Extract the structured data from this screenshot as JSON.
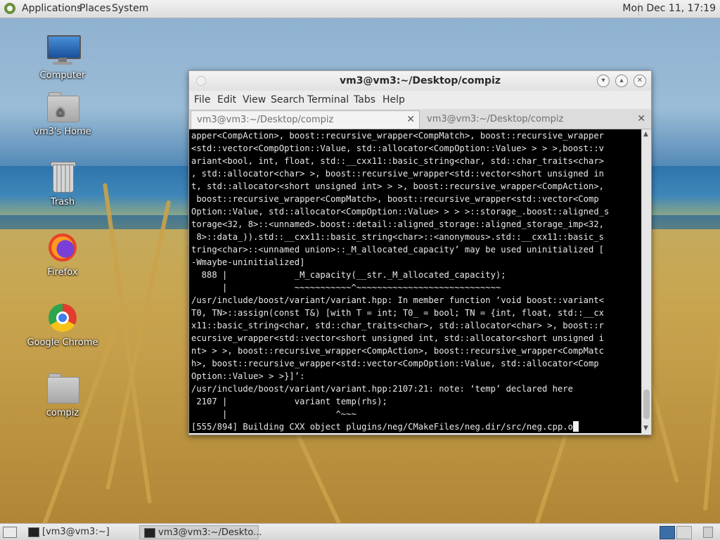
{
  "top_panel": {
    "menus": [
      "Applications",
      "Places",
      "System"
    ],
    "clock": "Mon Dec 11, 17:19"
  },
  "desktop_icons": [
    {
      "label": "Computer",
      "icon": "computer-icon"
    },
    {
      "label": "vm3's Home",
      "icon": "home-folder-icon"
    },
    {
      "label": "Trash",
      "icon": "trash-icon"
    },
    {
      "label": "Firefox",
      "icon": "firefox-icon"
    },
    {
      "label": "Google Chrome",
      "icon": "chrome-icon"
    },
    {
      "label": "compiz",
      "icon": "folder-icon"
    }
  ],
  "terminal": {
    "title": "vm3@vm3:~/Desktop/compiz",
    "menu": [
      "File",
      "Edit",
      "View",
      "Search",
      "Terminal",
      "Tabs",
      "Help"
    ],
    "tabs": [
      {
        "label": "vm3@vm3:~/Desktop/compiz",
        "active": true
      },
      {
        "label": "vm3@vm3:~/Desktop/compiz",
        "active": false
      }
    ],
    "lines": [
      "apper<CompAction>, boost::recursive_wrapper<CompMatch>, boost::recursive_wrapper",
      "<std::vector<CompOption::Value, std::allocator<CompOption::Value> > > >,boost::v",
      "ariant<bool, int, float, std::__cxx11::basic_string<char, std::char_traits<char>",
      ", std::allocator<char> >, boost::recursive_wrapper<std::vector<short unsigned in",
      "t, std::allocator<short unsigned int> > >, boost::recursive_wrapper<CompAction>,",
      " boost::recursive_wrapper<CompMatch>, boost::recursive_wrapper<std::vector<Comp",
      "Option::Value, std::allocator<CompOption::Value> > > >::storage_.boost::aligned_s",
      "torage<32, 8>::<unnamed>.boost::detail::aligned_storage::aligned_storage_imp<32,",
      " 8>::data_)).std::__cxx11::basic_string<char>::<anonymous>.std::__cxx11::basic_s",
      "tring<char>::<unnamed union>::_M_allocated_capacity’ may be used uninitialized [",
      "-Wmaybe-uninitialized]",
      "  888 |             _M_capacity(__str._M_allocated_capacity);",
      "      |             ~~~~~~~~~~~^~~~~~~~~~~~~~~~~~~~~~~~~~~~~",
      "/usr/include/boost/variant/variant.hpp: In member function ‘void boost::variant<",
      "T0, TN>::assign(const T&) [with T = int; T0_ = bool; TN = {int, float, std::__cx",
      "x11::basic_string<char, std::char_traits<char>, std::allocator<char> >, boost::r",
      "ecursive_wrapper<std::vector<short unsigned int, std::allocator<short unsigned i",
      "nt> > >, boost::recursive_wrapper<CompAction>, boost::recursive_wrapper<CompMatc",
      "h>, boost::recursive_wrapper<std::vector<CompOption::Value, std::allocator<Comp",
      "Option::Value> > >}]’:",
      "/usr/include/boost/variant/variant.hpp:2107:21: note: ‘temp’ declared here",
      " 2107 |             variant temp(rhs);",
      "      |                     ^~~~",
      "[555/894] Building CXX object plugins/neg/CMakeFiles/neg.dir/src/neg.cpp.o"
    ]
  },
  "taskbar": {
    "items": [
      {
        "label": "[vm3@vm3:~]",
        "active": false
      },
      {
        "label": "vm3@vm3:~/Deskto...",
        "active": true
      }
    ]
  }
}
